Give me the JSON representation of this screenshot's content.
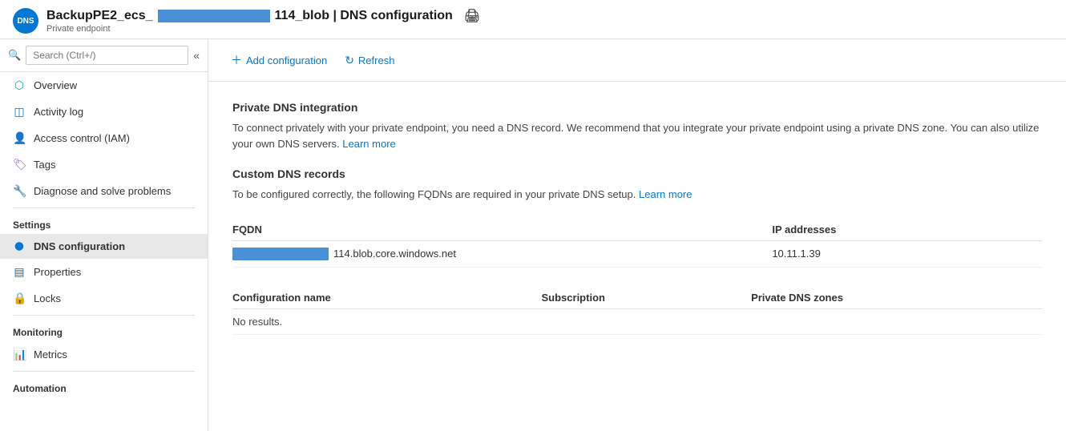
{
  "header": {
    "avatar_text": "DNS",
    "title_prefix": "BackupPE2_ecs_",
    "title_redacted": true,
    "title_suffix": "114_blob | DNS configuration",
    "subtitle": "Private endpoint",
    "print_label": "Print"
  },
  "sidebar": {
    "search_placeholder": "Search (Ctrl+/)",
    "collapse_label": "Collapse",
    "items": [
      {
        "id": "overview",
        "label": "Overview",
        "icon": "⬡",
        "active": false
      },
      {
        "id": "activity-log",
        "label": "Activity log",
        "icon": "◫",
        "active": false
      },
      {
        "id": "access-control",
        "label": "Access control (IAM)",
        "icon": "👤",
        "active": false
      },
      {
        "id": "tags",
        "label": "Tags",
        "icon": "🏷",
        "active": false
      },
      {
        "id": "diagnose",
        "label": "Diagnose and solve problems",
        "icon": "🔧",
        "active": false
      }
    ],
    "sections": [
      {
        "label": "Settings",
        "items": [
          {
            "id": "dns-configuration",
            "label": "DNS configuration",
            "icon": "⬤",
            "active": true
          },
          {
            "id": "properties",
            "label": "Properties",
            "icon": "▤",
            "active": false
          },
          {
            "id": "locks",
            "label": "Locks",
            "icon": "🔒",
            "active": false
          }
        ]
      },
      {
        "label": "Monitoring",
        "items": [
          {
            "id": "metrics",
            "label": "Metrics",
            "icon": "📊",
            "active": false
          }
        ]
      },
      {
        "label": "Automation",
        "items": []
      }
    ]
  },
  "toolbar": {
    "add_label": "Add configuration",
    "refresh_label": "Refresh"
  },
  "content": {
    "private_dns": {
      "title": "Private DNS integration",
      "description": "To connect privately with your private endpoint, you need a DNS record. We recommend that you integrate your private endpoint using a private DNS zone. You can also utilize your own DNS servers.",
      "learn_more": "Learn more"
    },
    "custom_dns": {
      "title": "Custom DNS records",
      "description": "To be configured correctly, the following FQDNs are required in your private DNS setup.",
      "learn_more": "Learn more",
      "table": {
        "headers": [
          "FQDN",
          "IP addresses"
        ],
        "rows": [
          {
            "fqdn_suffix": "114.blob.core.windows.net",
            "ip": "10.11.1.39"
          }
        ]
      }
    },
    "config_table": {
      "headers": [
        "Configuration name",
        "Subscription",
        "Private DNS zones"
      ],
      "no_results": "No results."
    }
  }
}
